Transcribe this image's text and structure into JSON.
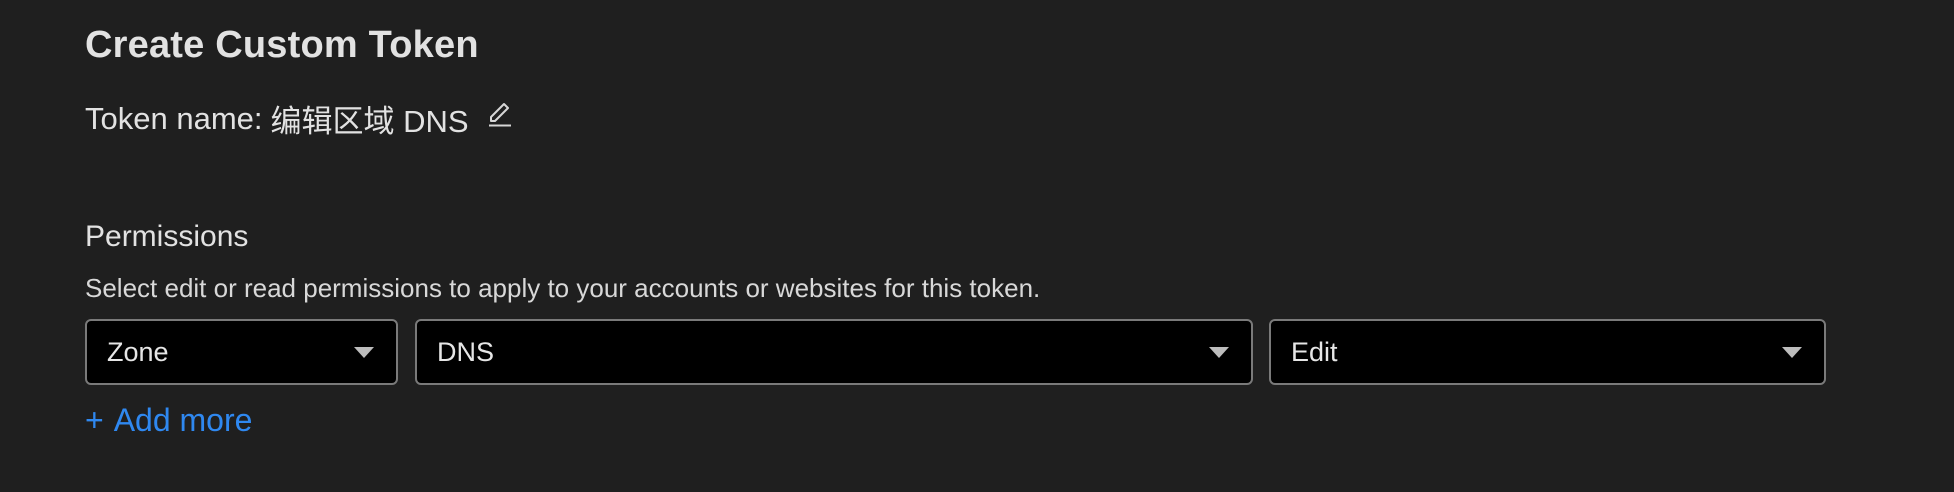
{
  "header": {
    "title": "Create Custom Token"
  },
  "token": {
    "label": "Token name:",
    "name": "编辑区域 DNS",
    "edit_icon": "pencil-icon"
  },
  "permissions": {
    "title": "Permissions",
    "description": "Select edit or read permissions to apply to your accounts or websites for this token.",
    "rows": [
      {
        "scope": "Zone",
        "resource": "DNS",
        "access": "Edit"
      }
    ],
    "add_more": {
      "icon": "+",
      "label": "Add more"
    }
  },
  "colors": {
    "background": "#1f1f1f",
    "select_background": "#000000",
    "select_border": "#7a7a7a",
    "link": "#2f88f0",
    "text": "#e2e2e2"
  }
}
